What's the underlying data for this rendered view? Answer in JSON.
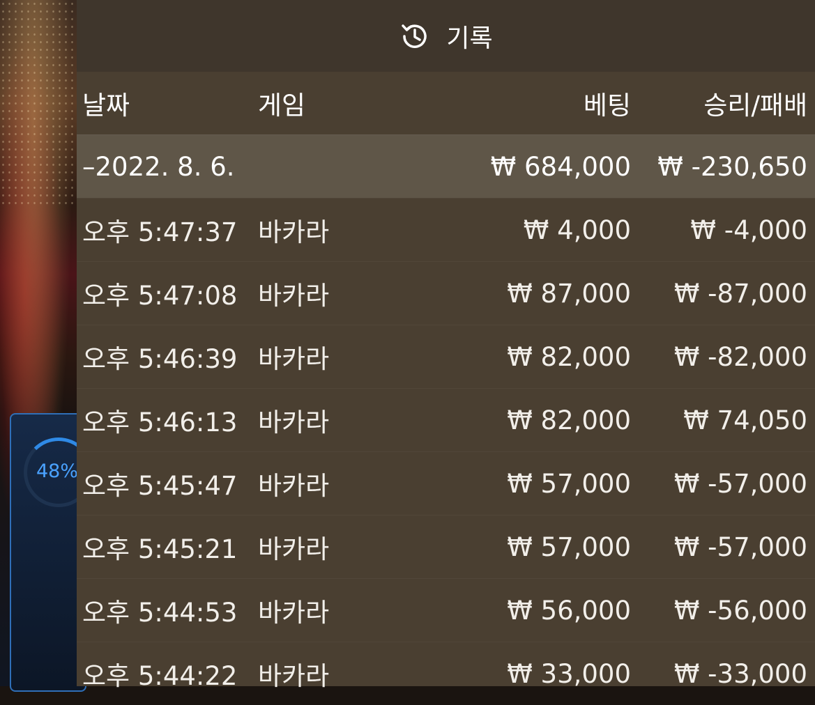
{
  "widget": {
    "progress_label": "48%",
    "progress": 0.48
  },
  "header": {
    "title": "기록",
    "icon": "history-icon"
  },
  "columns": {
    "date": "날짜",
    "game": "게임",
    "bet": "베팅",
    "result": "승리/패배"
  },
  "group": {
    "date": "–2022. 8. 6.",
    "bet_total": "₩ 684,000",
    "result_total": "₩ -230,650"
  },
  "rows": [
    {
      "time": "오후 5:47:37",
      "game": "바카라",
      "bet": "₩ 4,000",
      "result": "₩ -4,000"
    },
    {
      "time": "오후 5:47:08",
      "game": "바카라",
      "bet": "₩ 87,000",
      "result": "₩ -87,000"
    },
    {
      "time": "오후 5:46:39",
      "game": "바카라",
      "bet": "₩ 82,000",
      "result": "₩ -82,000"
    },
    {
      "time": "오후 5:46:13",
      "game": "바카라",
      "bet": "₩ 82,000",
      "result": "₩ 74,050"
    },
    {
      "time": "오후 5:45:47",
      "game": "바카라",
      "bet": "₩ 57,000",
      "result": "₩ -57,000"
    },
    {
      "time": "오후 5:45:21",
      "game": "바카라",
      "bet": "₩ 57,000",
      "result": "₩ -57,000"
    },
    {
      "time": "오후 5:44:53",
      "game": "바카라",
      "bet": "₩ 56,000",
      "result": "₩ -56,000"
    },
    {
      "time": "오후 5:44:22",
      "game": "바카라",
      "bet": "₩ 33,000",
      "result": "₩ -33,000"
    }
  ]
}
